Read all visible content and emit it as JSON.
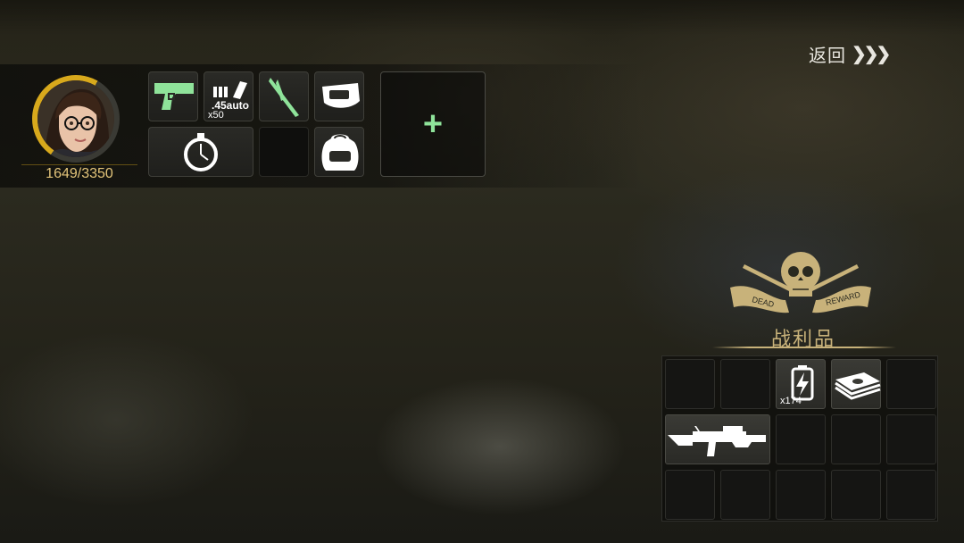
{
  "nav": {
    "back_label": "返回",
    "back_chevrons": "❯❯❯"
  },
  "character": {
    "hp_text": "1649/3350",
    "hp_current": 1649,
    "hp_max": 3350
  },
  "equipment": {
    "slots": [
      {
        "name": "pistol",
        "icon": "pistol-icon",
        "color": "#8fe39a"
      },
      {
        "name": "ammo",
        "icon": "ammo-icon",
        "label": ".45auto",
        "count": "x50"
      },
      {
        "name": "melee",
        "icon": "blade-icon",
        "color": "#8fe39a"
      },
      {
        "name": "pouch",
        "icon": "pouch-icon"
      },
      {
        "name": "stopwatch",
        "icon": "stopwatch-icon"
      },
      {
        "name": "empty",
        "icon": ""
      },
      {
        "name": "backpack",
        "icon": "backpack-icon"
      }
    ],
    "add_label": "+"
  },
  "loot": {
    "title": "战利品",
    "emblem_words": [
      "DEAD",
      "REWARD"
    ],
    "items": [
      {
        "icon": "battery-icon",
        "count": "x174"
      },
      {
        "icon": "cash-icon"
      },
      {
        "icon": "assault-rifle-icon"
      }
    ]
  },
  "colors": {
    "accent_gold": "#d8a91c",
    "loot_title": "#c8b27a",
    "rare_green": "#8fe39a"
  }
}
